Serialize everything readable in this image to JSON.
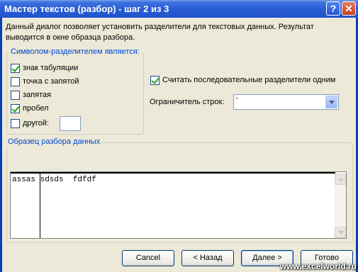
{
  "window": {
    "title": "Мастер текстов (разбор) - шаг 2 из 3",
    "help_label": "?",
    "close_label": "✕"
  },
  "description": "Данный диалог позволяет установить разделители для текстовых данных. Результат выводится в окне образца разбора.",
  "delimiters": {
    "legend": "Символом-разделителем является:",
    "tab": {
      "label": "знак табуляции",
      "checked": true
    },
    "semicolon": {
      "label": "точка с запятой",
      "checked": false
    },
    "comma": {
      "label": "запятая",
      "checked": false
    },
    "space": {
      "label": "пробел",
      "checked": true
    },
    "other": {
      "label": "другой:",
      "checked": false,
      "value": ""
    }
  },
  "consecutive": {
    "label": "Считать последовательные разделители одним",
    "checked": true
  },
  "text_qualifier": {
    "label": "Ограничитель строк:",
    "value": "'"
  },
  "preview": {
    "legend": "Образец разбора данных",
    "row_text": "assas sdsds  fdfdf"
  },
  "buttons": {
    "cancel": "Cancel",
    "back": "< Назад",
    "next": "Далее >",
    "finish": "Готово"
  },
  "watermark": "www.excelworld.ru",
  "colors": {
    "titlebar": "#2A5CD5",
    "legend_text": "#0046D5",
    "check": "#21A121",
    "dialog_bg": "#ECE9D8"
  }
}
